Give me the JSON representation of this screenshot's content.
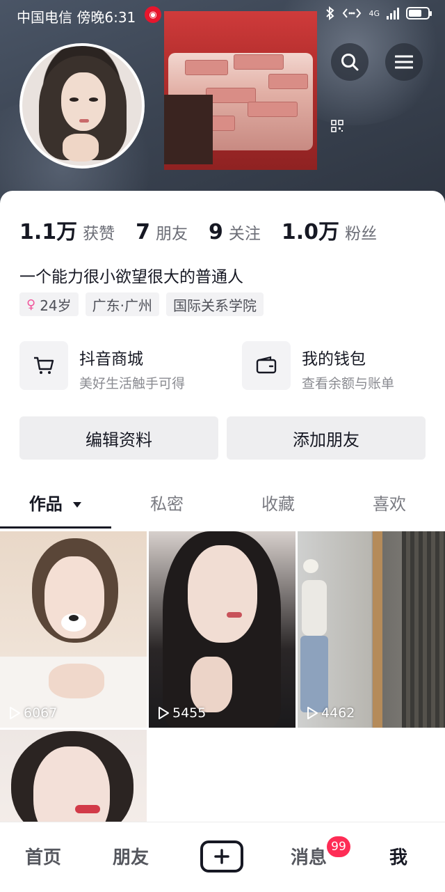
{
  "status_bar": {
    "carrier": "中国电信 傍晚6:31",
    "network": "4G",
    "icons": [
      "weibo-icon",
      "bluetooth-icon",
      "data-transfer-icon",
      "signal-icon",
      "battery-icon"
    ]
  },
  "header": {
    "icons": [
      "search-icon",
      "menu-icon",
      "qr-code-icon"
    ]
  },
  "stats": [
    {
      "num": "1.1万",
      "label": "获赞"
    },
    {
      "num": "7",
      "label": "朋友"
    },
    {
      "num": "9",
      "label": "关注"
    },
    {
      "num": "1.0万",
      "label": "粉丝"
    }
  ],
  "bio": "一个能力很小欲望很大的普通人",
  "tags": {
    "age": "24岁",
    "location": "广东·广州",
    "school": "国际关系学院"
  },
  "services": [
    {
      "title": "抖音商城",
      "subtitle": "美好生活触手可得",
      "icon": "cart-icon"
    },
    {
      "title": "我的钱包",
      "subtitle": "查看余额与账单",
      "icon": "wallet-icon"
    }
  ],
  "buttons": {
    "edit": "编辑资料",
    "add_friend": "添加朋友"
  },
  "tabs": [
    "作品",
    "私密",
    "收藏",
    "喜欢"
  ],
  "videos": [
    {
      "plays": "6067"
    },
    {
      "plays": "5455"
    },
    {
      "plays": "4462"
    },
    {
      "plays": ""
    }
  ],
  "nav": {
    "home": "首页",
    "friends": "朋友",
    "messages": "消息",
    "messages_badge": "99",
    "me": "我"
  },
  "colors": {
    "accent": "#fe2c55",
    "text": "#161823",
    "muted": "#6b6d76"
  }
}
